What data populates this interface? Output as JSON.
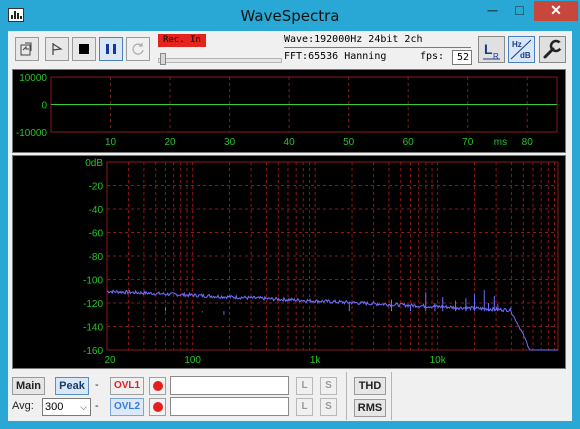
{
  "window": {
    "title": "WaveSpectra",
    "minimize_glyph": "─",
    "maximize_glyph": "□",
    "close_glyph": "✕"
  },
  "toolbar": {
    "rec_status": "Rec. In",
    "wave_label": "Wave:",
    "wave_value": "192000Hz 24bit 2ch",
    "fft_label": "FFT:",
    "fft_value": "65536 Hanning",
    "fps_label": "fps:",
    "fps_value": "52",
    "buttons": [
      "open-file",
      "marker",
      "stop",
      "pause",
      "refresh"
    ],
    "right_buttons": [
      "lr-channel",
      "hz-db-scale",
      "settings-wrench"
    ]
  },
  "waveform": {
    "y_ticks": [
      "10000",
      "0",
      "-10000"
    ],
    "x_ticks": [
      "10",
      "20",
      "30",
      "40",
      "50",
      "60",
      "70",
      "80"
    ],
    "x_unit": "ms"
  },
  "spectrum": {
    "y_ticks": [
      "0dB",
      "-20",
      "-40",
      "-60",
      "-80",
      "-100",
      "-120",
      "-140",
      "-160"
    ],
    "x_ticks": [
      "20",
      "100",
      "1k",
      "10k"
    ]
  },
  "colors": {
    "grid": "#8a1a1a",
    "axis_text": "#26c426",
    "wave_line": "#2fd02f",
    "spectrum_line": "#6f6fff",
    "background": "#000000"
  },
  "controls": {
    "main_label": "Main",
    "peak_label": "Peak",
    "dash": "-",
    "avg_label": "Avg:",
    "avg_value": "300",
    "ovl1_label": "OVL1",
    "ovl2_label": "OVL2",
    "l_label": "L",
    "s_label": "S",
    "thd_label": "THD",
    "rms_label": "RMS"
  }
}
